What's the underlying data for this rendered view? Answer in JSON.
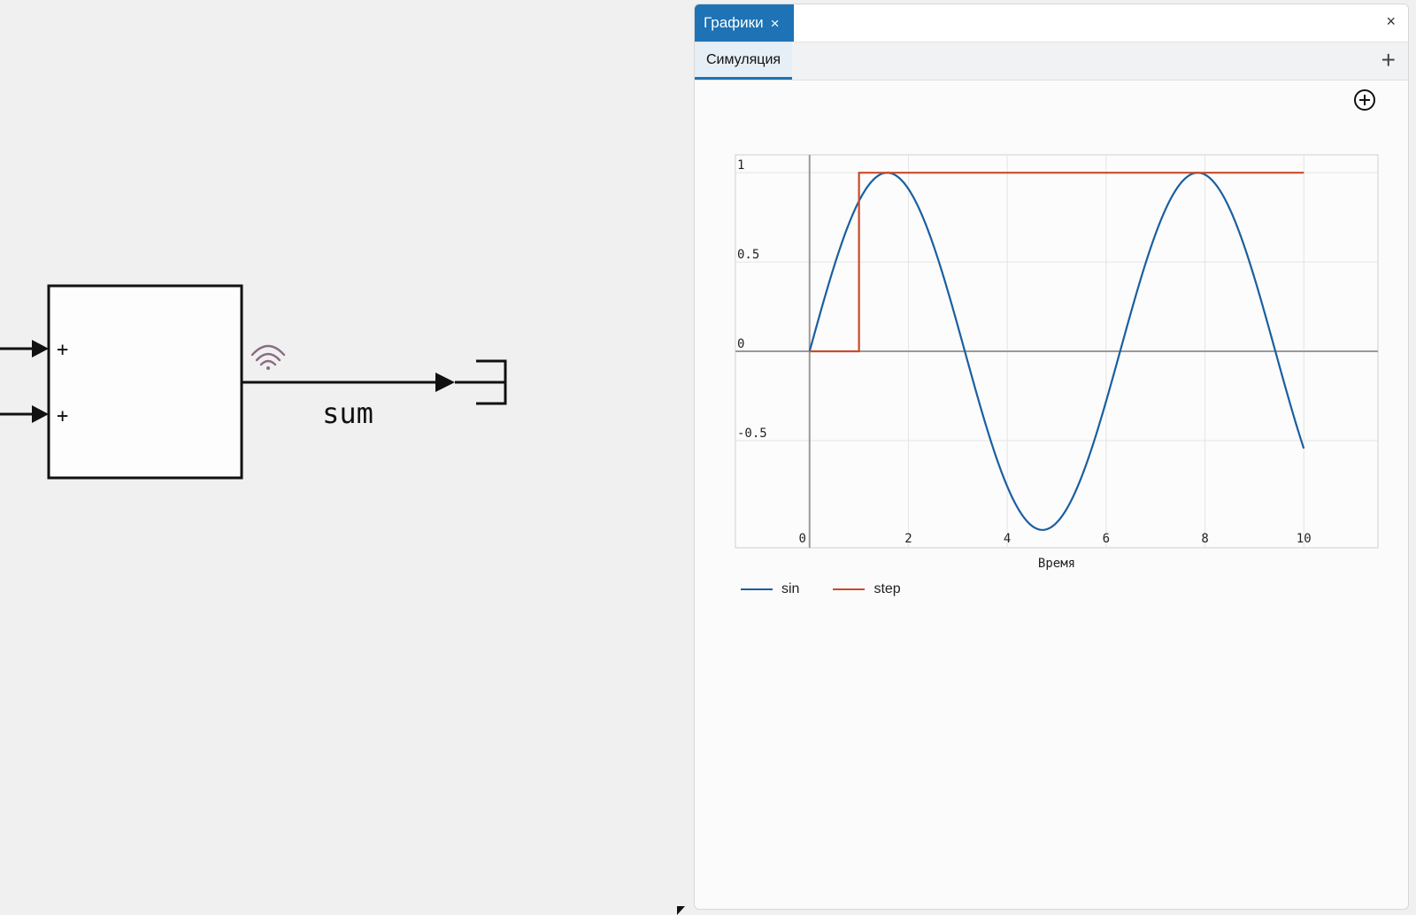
{
  "diagram": {
    "block": {
      "input_signs": [
        "+",
        "+"
      ]
    },
    "signal_label": "sum",
    "signal_color": "#111111",
    "wifi_color": "#8a6b83"
  },
  "panel": {
    "tab_label": "Графики",
    "tab_close": "×",
    "close_label": "×",
    "subtab_label": "Симуляция",
    "add_label": "+",
    "accent_color": "#1d73b5",
    "zoom_icon": "circle-plus-icon"
  },
  "chart_data": {
    "type": "line",
    "xlabel": "Время",
    "xlim": [
      -1.5,
      11.5
    ],
    "ylim": [
      -1.1,
      1.1
    ],
    "x_ticks": [
      0,
      2,
      4,
      6,
      8,
      10
    ],
    "y_ticks": [
      1,
      0.5,
      0,
      -0.5
    ],
    "x_tick_labels": [
      "0",
      "2",
      "4",
      "6",
      "8",
      "10"
    ],
    "y_tick_labels": [
      "1",
      "0.5",
      "0",
      "-0.5"
    ],
    "grid": true,
    "legend_position": "bottom-left",
    "series": [
      {
        "name": "sin",
        "color": "#1a5fa0",
        "x": [
          0,
          0.5,
          1,
          1.5,
          1.571,
          2,
          2.5,
          3,
          3.5,
          4,
          4.5,
          4.712,
          5,
          5.5,
          6,
          6.5,
          7,
          7.5,
          7.854,
          8,
          8.5,
          9,
          9.5,
          10
        ],
        "y": [
          0,
          0.479,
          0.841,
          0.997,
          1,
          0.909,
          0.598,
          0.141,
          -0.351,
          -0.757,
          -0.978,
          -1,
          -0.959,
          -0.706,
          -0.279,
          0.215,
          0.657,
          0.938,
          1,
          0.989,
          0.798,
          0.412,
          -0.075,
          -0.544
        ]
      },
      {
        "name": "step",
        "color": "#c94b2b",
        "x": [
          0,
          1,
          1,
          10
        ],
        "y": [
          0,
          0,
          1,
          1
        ]
      }
    ]
  }
}
